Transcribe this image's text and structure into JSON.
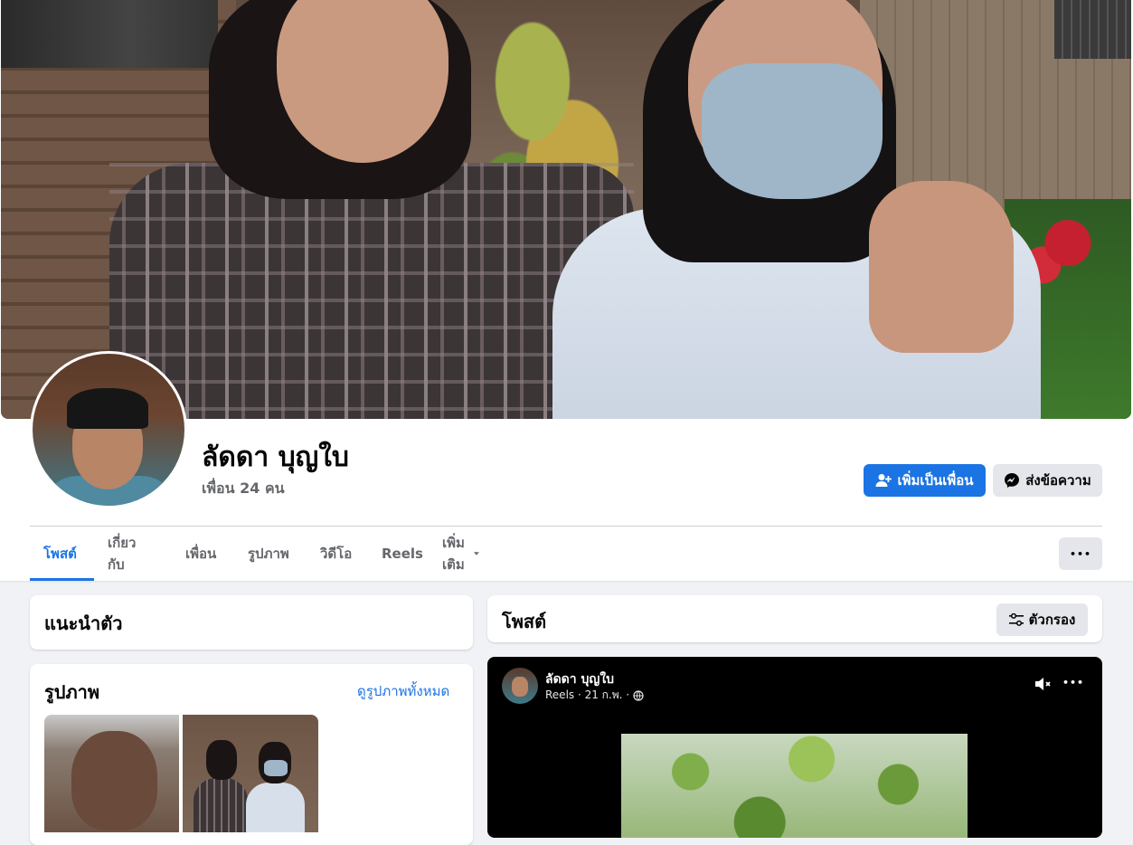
{
  "profile": {
    "name": "ลัดดา บุญใบ",
    "friends": "เพื่อน 24 คน"
  },
  "actions": {
    "add_friend": "เพิ่มเป็นเพื่อน",
    "message": "ส่งข้อความ",
    "more": "•••"
  },
  "tabs": [
    {
      "label": "โพสต์",
      "active": true
    },
    {
      "label": "เกี่ยวกับ",
      "active": false
    },
    {
      "label": "เพื่อน",
      "active": false
    },
    {
      "label": "รูปภาพ",
      "active": false
    },
    {
      "label": "วิดีโอ",
      "active": false
    },
    {
      "label": "Reels",
      "active": false
    },
    {
      "label": "เพิ่มเติม",
      "active": false
    }
  ],
  "intro": {
    "title": "แนะนำตัว"
  },
  "photos": {
    "title": "รูปภาพ",
    "see_all": "ดูรูปภาพทั้งหมด"
  },
  "posts": {
    "title": "โพสต์",
    "filter": "ตัวกรอง"
  },
  "reel_post": {
    "author": "ลัดดา บุญใบ",
    "meta": "Reels · 21 ก.พ. ·",
    "more": "•••"
  },
  "colors": {
    "accent": "#1b74e4",
    "page_bg": "#f0f2f5",
    "secondary_button": "#e4e6eb"
  },
  "icons": {
    "add_friend": "person-plus-icon",
    "message": "messenger-icon",
    "filter": "filter-sliders-icon",
    "dropdown": "caret-down-icon",
    "privacy": "globe-icon",
    "mute": "speaker-muted-icon"
  }
}
